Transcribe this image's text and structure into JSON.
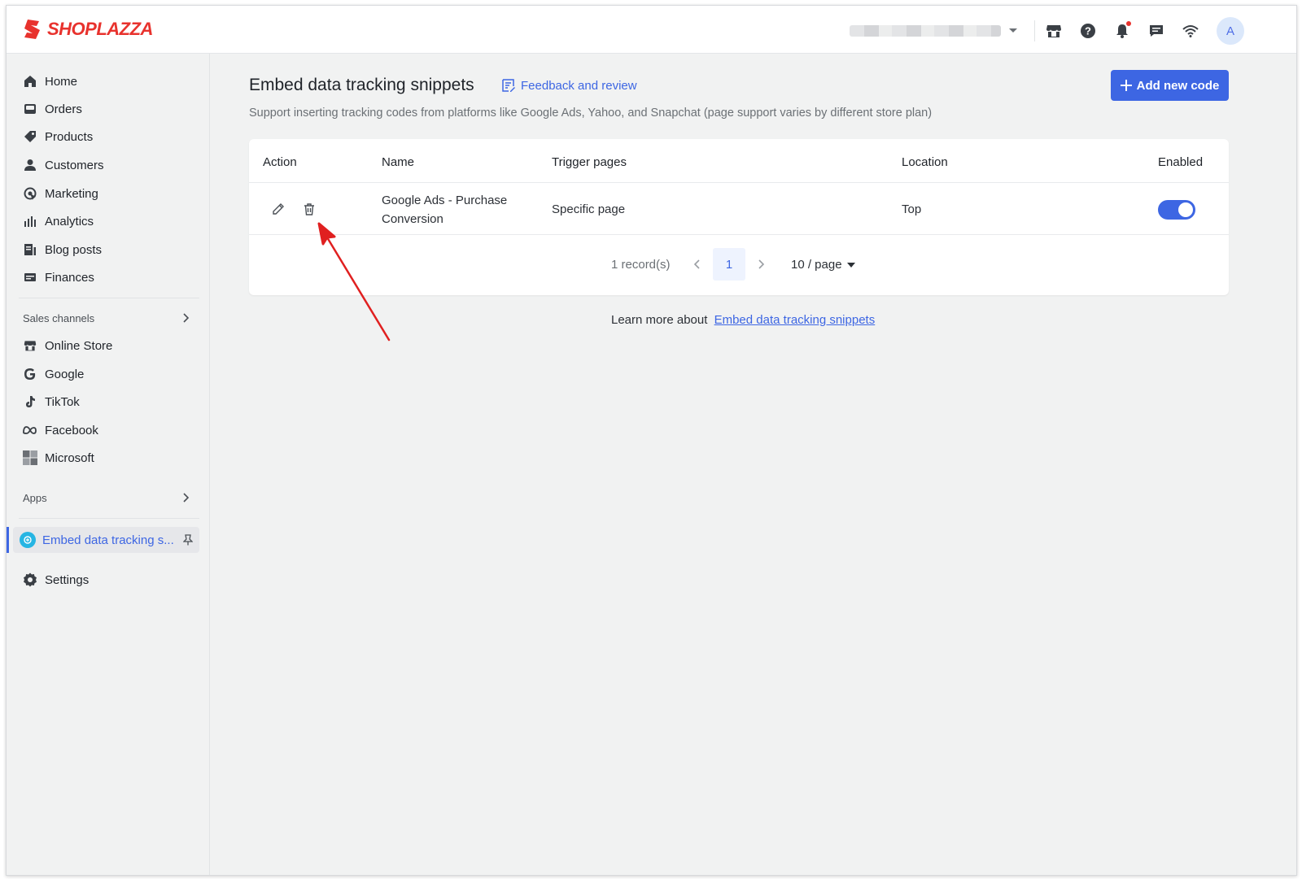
{
  "brand": {
    "name": "SHOPLAZZA",
    "color": "#e8322d"
  },
  "topbar": {
    "icons": [
      "store-icon",
      "help-icon",
      "bell-icon",
      "chat-icon",
      "wifi-icon"
    ],
    "avatar_initial": "A"
  },
  "sidebar": {
    "items": [
      {
        "label": "Home",
        "icon": "home-icon"
      },
      {
        "label": "Orders",
        "icon": "orders-icon"
      },
      {
        "label": "Products",
        "icon": "tag-icon"
      },
      {
        "label": "Customers",
        "icon": "user-icon"
      },
      {
        "label": "Marketing",
        "icon": "marketing-icon"
      },
      {
        "label": "Analytics",
        "icon": "bar-chart-icon"
      },
      {
        "label": "Blog posts",
        "icon": "blog-icon"
      },
      {
        "label": "Finances",
        "icon": "finance-icon"
      }
    ],
    "sales_channels": {
      "label": "Sales channels",
      "items": [
        {
          "label": "Online Store",
          "icon": "store-icon"
        },
        {
          "label": "Google",
          "icon": "google-icon"
        },
        {
          "label": "TikTok",
          "icon": "tiktok-icon"
        },
        {
          "label": "Facebook",
          "icon": "meta-icon"
        },
        {
          "label": "Microsoft",
          "icon": "microsoft-icon"
        }
      ]
    },
    "apps": {
      "label": "Apps",
      "active_item": "Embed data tracking s..."
    },
    "settings": "Settings"
  },
  "page": {
    "title": "Embed data tracking snippets",
    "feedback_link": "Feedback and review",
    "subtitle": "Support inserting tracking codes from platforms like Google Ads, Yahoo, and Snapchat (page support varies by different store plan)",
    "add_button": "Add new code"
  },
  "table": {
    "columns": [
      "Action",
      "Name",
      "Trigger pages",
      "Location",
      "Enabled"
    ],
    "rows": [
      {
        "name": "Google Ads - Purchase Conversion",
        "trigger": "Specific page",
        "location": "Top",
        "enabled": true
      }
    ]
  },
  "pagination": {
    "records": "1 record(s)",
    "current_page": "1",
    "page_size": "10 / page"
  },
  "footer": {
    "learn_prefix": "Learn more about",
    "learn_link": "Embed data tracking snippets"
  },
  "colors": {
    "accent": "#3d66e3",
    "annotation_arrow": "#e02020"
  }
}
